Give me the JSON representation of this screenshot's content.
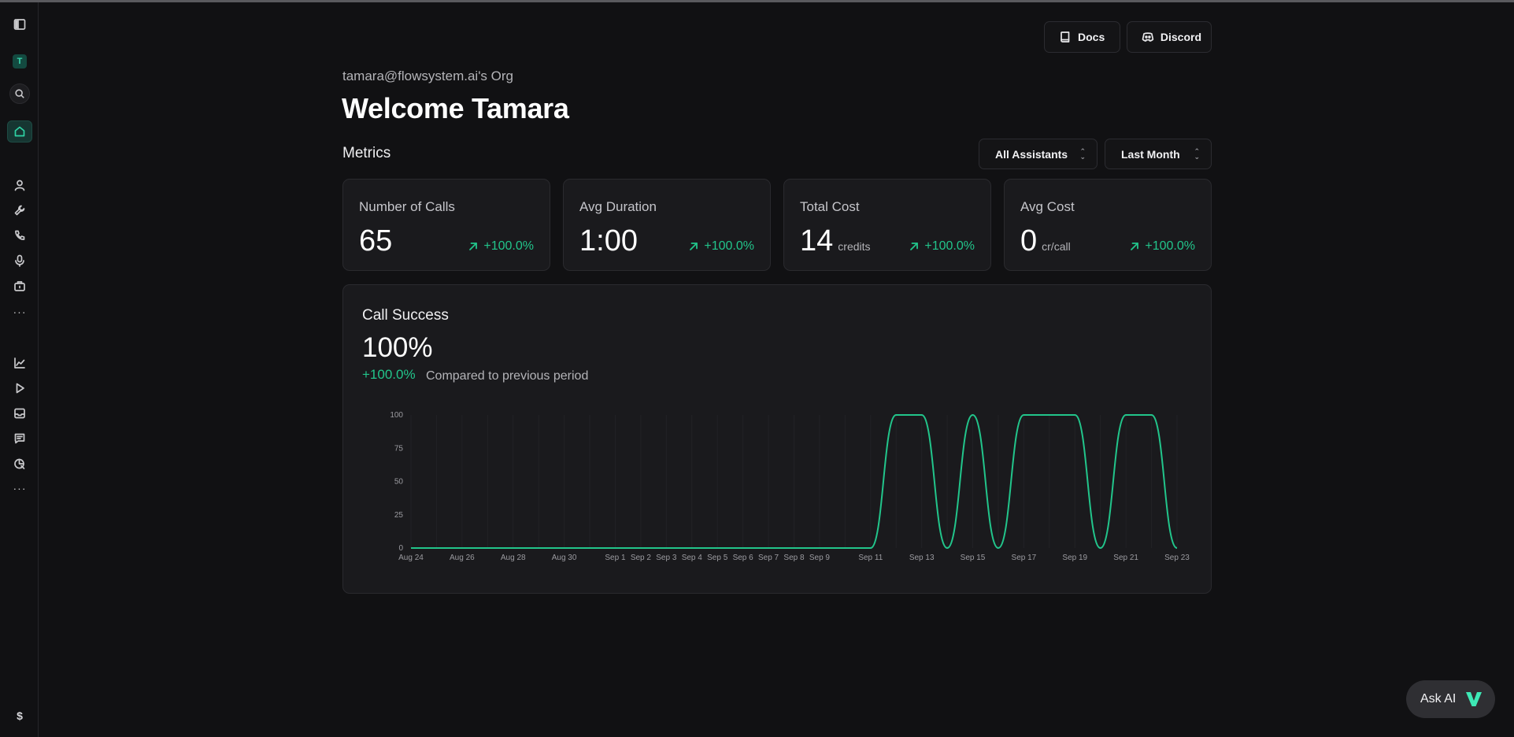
{
  "sidebar": {
    "avatar_letter": "T",
    "more_label": "···",
    "billing_label": "$"
  },
  "header": {
    "docs_label": "Docs",
    "discord_label": "Discord",
    "org_name": "tamara@flowsystem.ai's Org",
    "welcome": "Welcome Tamara"
  },
  "metrics": {
    "title": "Metrics",
    "assistant_filter": "All Assistants",
    "period_filter": "Last Month",
    "cards": [
      {
        "label": "Number of Calls",
        "value": "65",
        "unit": "",
        "delta": "+100.0%"
      },
      {
        "label": "Avg Duration",
        "value": "1:00",
        "unit": "",
        "delta": "+100.0%"
      },
      {
        "label": "Total Cost",
        "value": "14",
        "unit": "credits",
        "delta": "+100.0%"
      },
      {
        "label": "Avg Cost",
        "value": "0",
        "unit": "cr/call",
        "delta": "+100.0%"
      }
    ]
  },
  "call_success": {
    "title": "Call Success",
    "value": "100%",
    "delta": "+100.0%",
    "compare_text": "Compared to previous period"
  },
  "chart_data": {
    "type": "line",
    "title": "",
    "xlabel": "",
    "ylabel": "",
    "ylim": [
      0,
      100
    ],
    "yticks": [
      0,
      25,
      50,
      75,
      100
    ],
    "grid": true,
    "color": "#22c58b",
    "x_tick_labels": [
      "Aug 24",
      "Aug 26",
      "Aug 28",
      "Aug 30",
      "Sep 1",
      "Sep 2",
      "Sep 3",
      "Sep 4",
      "Sep 5",
      "Sep 6",
      "Sep 7",
      "Sep 8",
      "Sep 9",
      "Sep 11",
      "Sep 13",
      "Sep 15",
      "Sep 17",
      "Sep 19",
      "Sep 21",
      "Sep 23"
    ],
    "x": [
      "Aug 24",
      "Aug 25",
      "Aug 26",
      "Aug 27",
      "Aug 28",
      "Aug 29",
      "Aug 30",
      "Aug 31",
      "Sep 1",
      "Sep 2",
      "Sep 3",
      "Sep 4",
      "Sep 5",
      "Sep 6",
      "Sep 7",
      "Sep 8",
      "Sep 9",
      "Sep 10",
      "Sep 11",
      "Sep 12",
      "Sep 13",
      "Sep 14",
      "Sep 15",
      "Sep 16",
      "Sep 17",
      "Sep 18",
      "Sep 19",
      "Sep 20",
      "Sep 21",
      "Sep 22",
      "Sep 23"
    ],
    "values": [
      0,
      0,
      0,
      0,
      0,
      0,
      0,
      0,
      0,
      0,
      0,
      0,
      0,
      0,
      0,
      0,
      0,
      0,
      0,
      100,
      100,
      0,
      100,
      0,
      100,
      100,
      100,
      0,
      100,
      100,
      0
    ]
  },
  "ask_ai": {
    "label": "Ask AI"
  }
}
